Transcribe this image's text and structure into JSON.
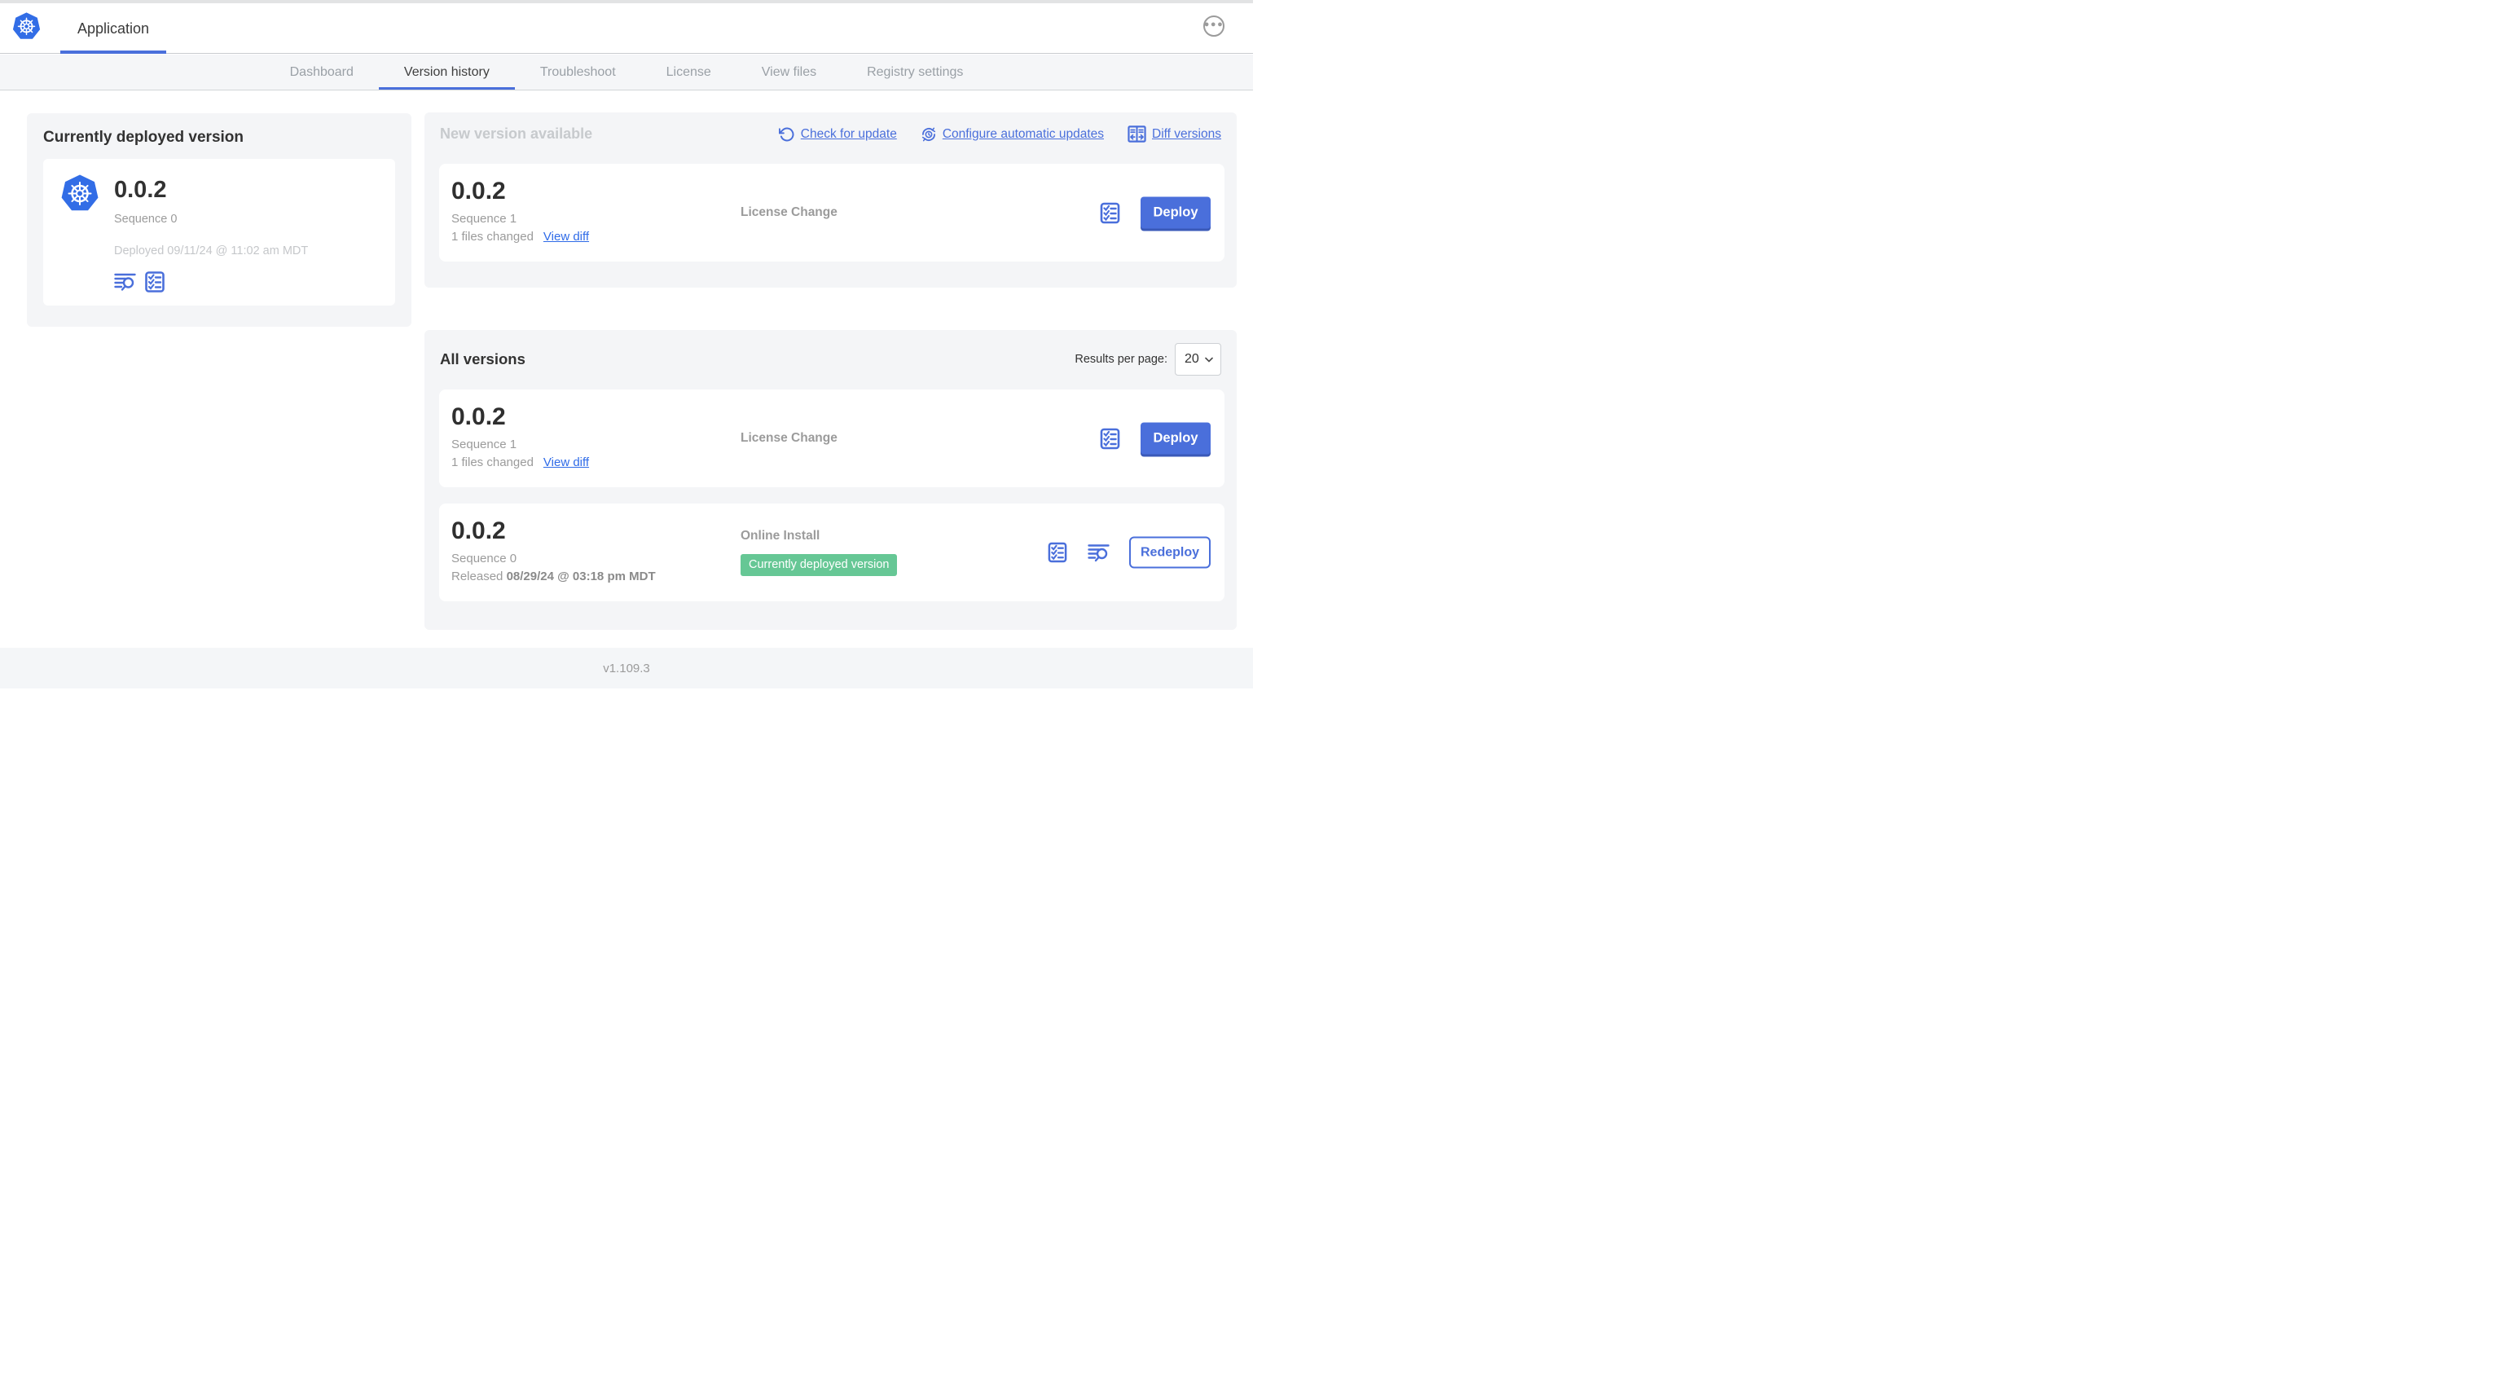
{
  "colors": {
    "accent": "#4a6fdb",
    "k8s_blue": "#326de6",
    "badge_green": "#66c795",
    "panel_bg": "#f4f5f7"
  },
  "topbar": {
    "app_tab_label": "Application"
  },
  "nav_tabs": [
    {
      "label": "Dashboard",
      "active": false
    },
    {
      "label": "Version history",
      "active": true
    },
    {
      "label": "Troubleshoot",
      "active": false
    },
    {
      "label": "License",
      "active": false
    },
    {
      "label": "View files",
      "active": false
    },
    {
      "label": "Registry settings",
      "active": false
    }
  ],
  "deployed_panel": {
    "title": "Currently deployed version",
    "version": "0.0.2",
    "sequence": "Sequence 0",
    "deployed_at": "Deployed 09/11/24 @ 11:02 am MDT"
  },
  "new_version_panel": {
    "title": "New version available",
    "check_for_update": "Check for update",
    "configure_updates": "Configure automatic updates",
    "diff_versions": "Diff versions",
    "card": {
      "version": "0.0.2",
      "sequence": "Sequence 1",
      "files_changed": "1 files changed",
      "view_diff": "View diff",
      "change_type": "License Change",
      "action": "Deploy"
    }
  },
  "all_versions_panel": {
    "title": "All versions",
    "results_per_page_label": "Results per page:",
    "results_per_page": "20",
    "rows": [
      {
        "version": "0.0.2",
        "sequence": "Sequence 1",
        "files_changed": "1 files changed",
        "view_diff": "View diff",
        "change_type": "License Change",
        "action": "Deploy"
      },
      {
        "version": "0.0.2",
        "sequence": "Sequence 0",
        "released_label": "Released",
        "released_date": "08/29/24 @ 03:18 pm MDT",
        "change_type": "Online Install",
        "badge": "Currently deployed version",
        "action": "Redeploy"
      }
    ]
  },
  "footer": {
    "version": "v1.109.3"
  }
}
